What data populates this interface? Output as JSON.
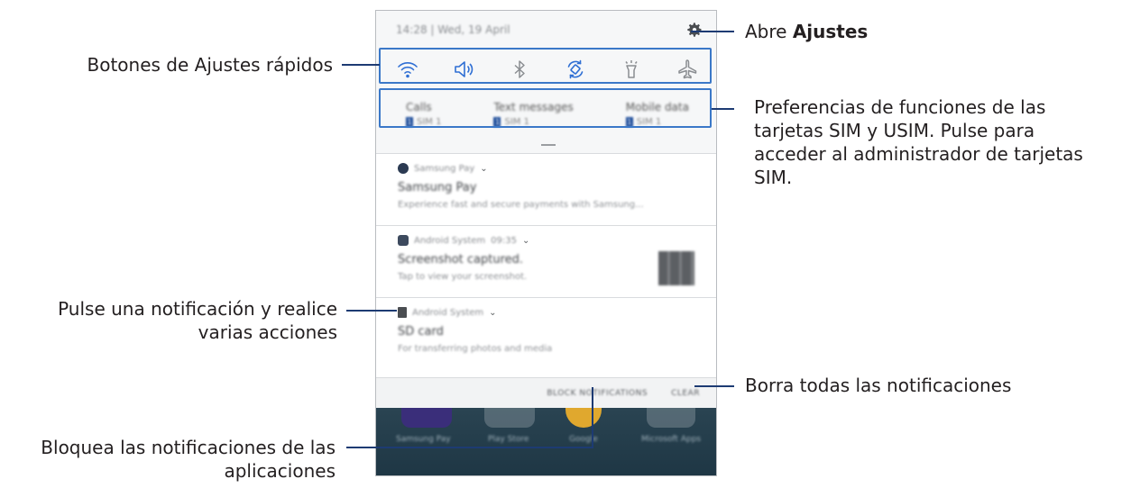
{
  "phone": {
    "status_text": "14:28  |  Wed, 19 April",
    "quick_settings": [
      {
        "name": "wifi-icon",
        "label": "Wi-Fi"
      },
      {
        "name": "sound-icon",
        "label": "Sound"
      },
      {
        "name": "bluetooth-icon",
        "label": "Bluetooth"
      },
      {
        "name": "auto-rotate-icon",
        "label": "Auto rotate"
      },
      {
        "name": "flashlight-icon",
        "label": "Flashlight"
      },
      {
        "name": "airplane-mode-icon",
        "label": "Airplane mode"
      }
    ],
    "sim": [
      {
        "title": "Calls",
        "badge": "1",
        "sim": "SIM 1"
      },
      {
        "title": "Text messages",
        "badge": "1",
        "sim": "SIM 1"
      },
      {
        "title": "Mobile data",
        "badge": "1",
        "sim": "SIM 1"
      }
    ],
    "notifications": [
      {
        "app": "Samsung Pay",
        "time": "",
        "title": "Samsung Pay",
        "text": "Experience fast and secure payments with Samsung..."
      },
      {
        "app": "Android System",
        "time": "09:35",
        "title": "Screenshot captured.",
        "text": "Tap to view your screenshot."
      },
      {
        "app": "Android System",
        "time": "",
        "title": "SD card",
        "text": "For transferring photos and media"
      }
    ],
    "actions": {
      "block": "BLOCK NOTIFICATIONS",
      "clear": "CLEAR"
    },
    "home_apps": [
      "Samsung Pay",
      "Play Store",
      "Google",
      "Microsoft Apps"
    ]
  },
  "callouts": {
    "quick_settings": "Botones de Ajustes rápidos",
    "tap_notification_1": "Pulse una notificación y realice",
    "tap_notification_2": "varias acciones",
    "block_1": "Bloquea las notificaciones de las",
    "block_2": "aplicaciones",
    "settings_prefix": "Abre ",
    "settings_bold": "Ajustes",
    "sim_1": "Preferencias de funciones de las",
    "sim_2": "tarjetas SIM y USIM. Pulse para",
    "sim_3": "acceder al administrador de tarjetas",
    "sim_4": "SIM.",
    "clear": "Borra todas las notificaciones"
  },
  "colors": {
    "accent": "#2f6fd4",
    "callout_line": "#1d3b73",
    "highlight_border": "#3b78c8"
  }
}
